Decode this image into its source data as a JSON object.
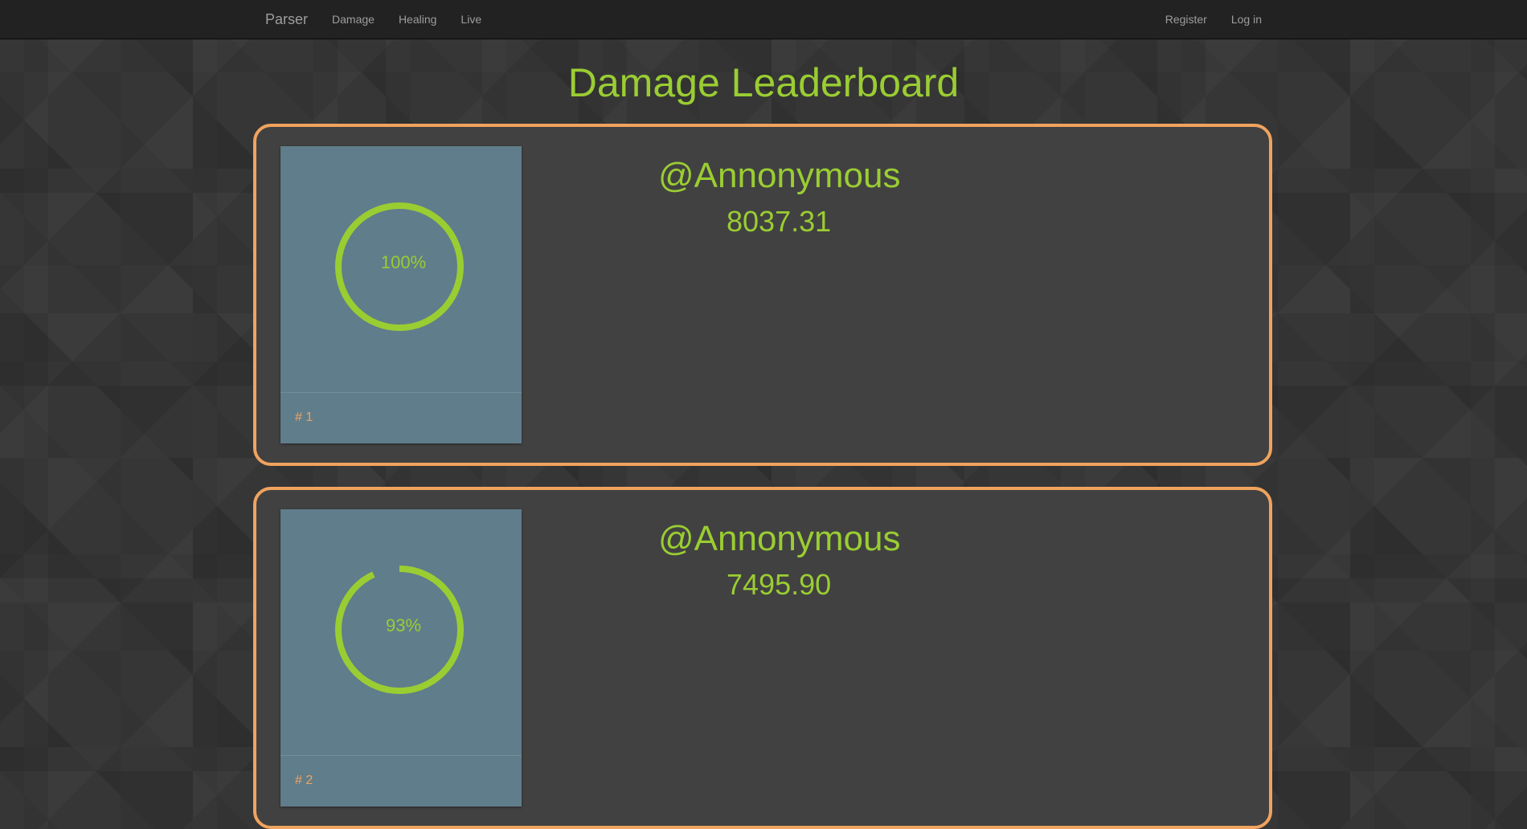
{
  "nav": {
    "brand": "Parser",
    "links": [
      "Damage",
      "Healing",
      "Live"
    ],
    "right_links": [
      "Register",
      "Log in"
    ]
  },
  "page": {
    "title": "Damage Leaderboard"
  },
  "colors": {
    "accent_green": "#9acd32",
    "border_orange": "#f0a35e",
    "card_bg": "#607d8b",
    "navbar_bg": "#222222"
  },
  "entries": [
    {
      "rank": "# 1",
      "name": "@Annonymous",
      "score": "8037.31",
      "percent_label": "100%",
      "percent": 100
    },
    {
      "rank": "# 2",
      "name": "@Annonymous",
      "score": "7495.90",
      "percent_label": "93%",
      "percent": 93
    }
  ]
}
